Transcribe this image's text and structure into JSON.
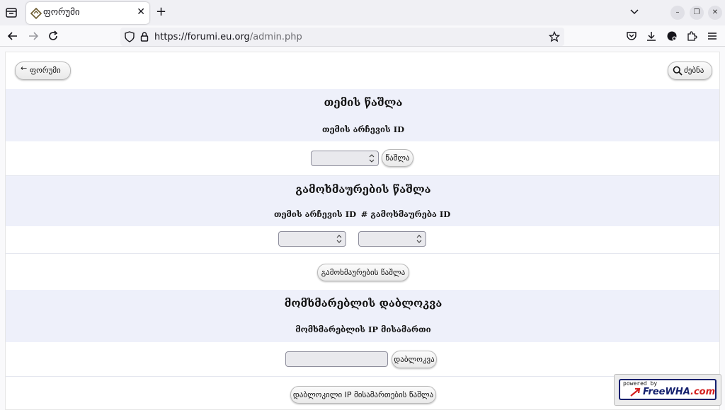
{
  "browser": {
    "tab_title": "ფორუმი",
    "url_base": "https://forumi.eu.org",
    "url_path": "/admin.php"
  },
  "page": {
    "back_button": "ფორუმი",
    "search_button": "ძებნა",
    "sections": {
      "delete_topic": {
        "title": "თემის წაშლა",
        "label": "თემის არჩევის ID",
        "button": "წაშლა"
      },
      "delete_reply": {
        "title": "გამოხმაურების წაშლა",
        "label_topic": "თემის არჩევის ID",
        "label_reply": "# გამოხმაურება ID",
        "button": "გამოხმაურების წაშლა"
      },
      "block_user": {
        "title": "მომხმარებლის დაბლოკვა",
        "label": "მომხმარებლის IP მისამართი",
        "button": "დაბლოკვა",
        "delete_button": "დაბლოკილი IP მისამართების წაშლა"
      }
    },
    "badge": {
      "powered": "powered by",
      "brand": "FreeWHA",
      "brand_suffix": ".com"
    }
  }
}
